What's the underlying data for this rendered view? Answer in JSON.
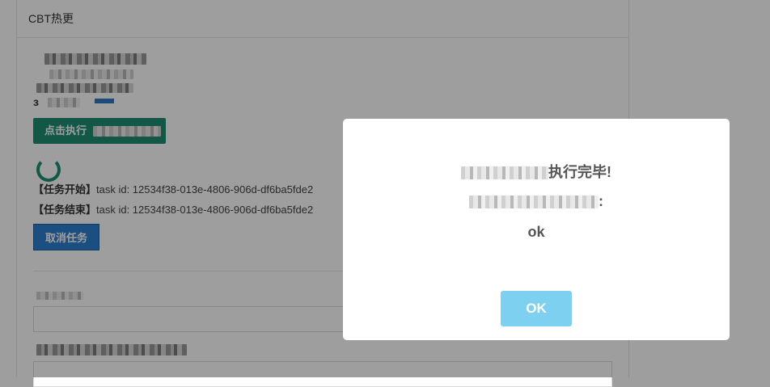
{
  "panel": {
    "title": "CBT热更",
    "partial_char": "з"
  },
  "exec_button": {
    "label": "点击执行"
  },
  "tasks": [
    {
      "tag": "【任务开始】",
      "text": "task id: 12534f38-013e-4806-906d-df6ba5fde2"
    },
    {
      "tag": "【任务结束】",
      "text": "task id: 12534f38-013e-4806-906d-df6ba5fde2"
    }
  ],
  "cancel_button": {
    "label": "取消任务"
  },
  "modal": {
    "message_suffix": "执行完毕!",
    "result_suffix": ":",
    "result_value": "ok",
    "ok_label": "OK"
  },
  "colors": {
    "exec_button": "#1f8f72",
    "cancel_button": "#2d7fd1",
    "ok_button": "#7dd0ef",
    "overlay": "rgba(0,0,0,0.38)"
  }
}
